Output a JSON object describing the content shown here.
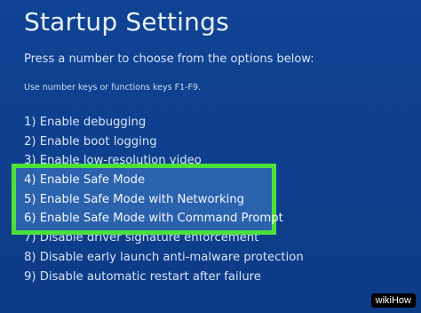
{
  "screen": {
    "title": "Startup Settings",
    "prompt": "Press a number to choose from the options below:",
    "hint": "Use number keys or functions keys F1-F9."
  },
  "options": [
    "1) Enable debugging",
    "2) Enable boot logging",
    "3) Enable low-resolution video",
    "4) Enable Safe Mode",
    "5) Enable Safe Mode with Networking",
    "6) Enable Safe Mode with Command Prompt",
    "7) Disable driver signature enforcement",
    "8) Disable early launch anti-malware protection",
    "9) Disable automatic restart after failure"
  ],
  "highlight": {
    "color": "#4ee03a",
    "fill": "#2a62ad",
    "items": [
      "4) Enable Safe Mode",
      "5) Enable Safe Mode with Networking",
      "6) Enable Safe Mode with Command Prompt"
    ]
  },
  "watermark": "wikiHow"
}
